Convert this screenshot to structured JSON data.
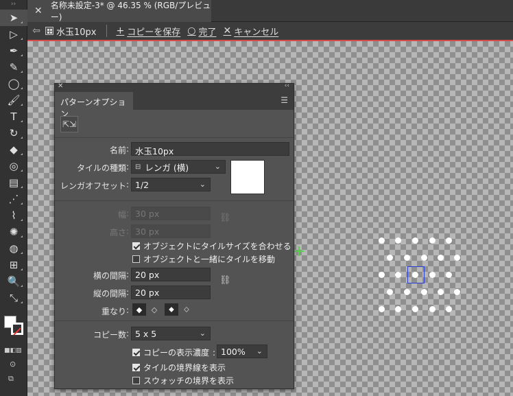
{
  "document_tab": {
    "close_icon": "close-icon",
    "title": "名称未設定-3* @ 46.35 % (RGB/プレビュー)"
  },
  "edit_bar": {
    "pattern_name": "水玉10px",
    "save_copy": "コピーを保存",
    "done": "完了",
    "cancel": "キャンセル",
    "accent_line_color": "#d74a4a"
  },
  "toolbar": {
    "tools": [
      "selection",
      "direct-selection",
      "pen",
      "curvature",
      "ellipse",
      "paintbrush",
      "type",
      "rotate",
      "eraser",
      "shape-builder",
      "gradient",
      "eyedropper",
      "blend",
      "symbol-sprayer",
      "artboard",
      "slice",
      "zoom",
      "hand"
    ]
  },
  "panel": {
    "title": "パターンオプション",
    "name_label": "名前",
    "name_value": "水玉10px",
    "tile_type_label": "タイルの種類",
    "tile_type_value": "レンガ (横)",
    "brick_offset_label": "レンガオフセット",
    "brick_offset_value": "1/2",
    "width_label": "幅",
    "width_value": "30 px",
    "height_label": "高さ",
    "height_value": "30 px",
    "fit_tile_label": "オブジェクトにタイルサイズを合わせる",
    "fit_tile_checked": true,
    "move_tile_label": "オブジェクトと一緒にタイルを移動",
    "move_tile_checked": false,
    "h_spacing_label": "横の間隔",
    "h_spacing_value": "20 px",
    "v_spacing_label": "縦の間隔",
    "v_spacing_value": "20 px",
    "overlap_label": "重なり",
    "copies_label": "コピー数",
    "copies_value": "5 x 5",
    "dim_copies_label": "コピーの表示濃度",
    "dim_copies_checked": true,
    "dim_copies_value": "100%",
    "show_tile_edge_label": "タイルの境界線を表示",
    "show_tile_edge_checked": true,
    "show_swatch_bounds_label": "スウォッチの境界を表示",
    "show_swatch_bounds_checked": false
  },
  "canvas": {
    "dot_color": "#ffffff",
    "tile_border_color": "#2a3fd6",
    "center_mark_color": "#59d14e"
  }
}
